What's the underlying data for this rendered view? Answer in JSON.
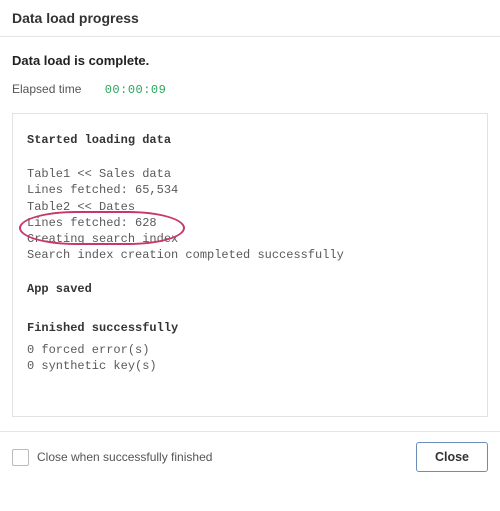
{
  "dialog": {
    "title": "Data load progress",
    "status": "Data load is complete.",
    "elapsed_label": "Elapsed time",
    "elapsed_value": "00:00:09"
  },
  "log": {
    "start_heading": "Started loading data",
    "lines": [
      "Table1 << Sales data",
      "Lines fetched: 65,534",
      "Table2 << Dates",
      "Lines fetched: 628",
      "Creating search index",
      "Search index creation completed successfully"
    ],
    "app_saved_heading": "App saved",
    "finish_heading": "Finished successfully",
    "finish_lines": [
      "0 forced error(s)",
      "0 synthetic key(s)"
    ]
  },
  "footer": {
    "checkbox_label": "Close when successfully finished",
    "close_button": "Close"
  }
}
